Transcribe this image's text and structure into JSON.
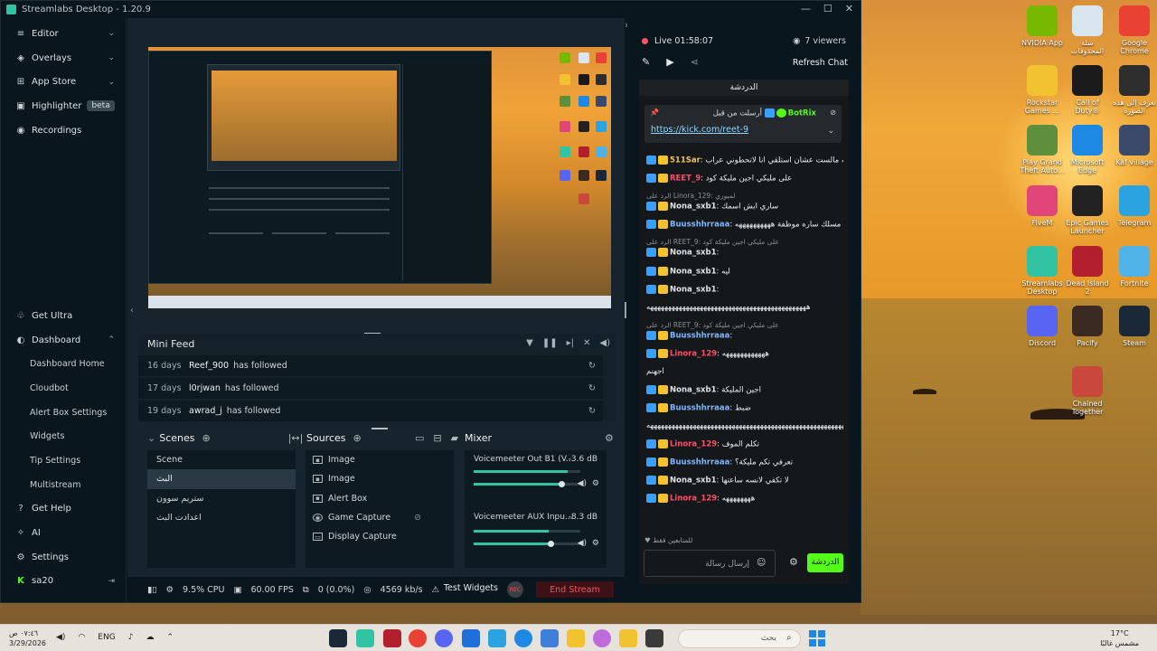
{
  "app": {
    "title": "Streamlabs Desktop - 1.20.9"
  },
  "sidebar": {
    "items": [
      {
        "label": "Editor"
      },
      {
        "label": "Overlays"
      },
      {
        "label": "App Store"
      },
      {
        "label": "Highlighter",
        "badge": "beta"
      },
      {
        "label": "Recordings"
      }
    ],
    "bottom": [
      {
        "label": "Get Ultra"
      },
      {
        "label": "Dashboard"
      }
    ],
    "dashboard_sub": [
      "Dashboard Home",
      "Cloudbot",
      "Alert Box Settings",
      "Widgets",
      "Tip Settings",
      "Multistream"
    ],
    "footer": [
      {
        "label": "Get Help"
      },
      {
        "label": "AI"
      },
      {
        "label": "Settings"
      }
    ],
    "user": "sa20"
  },
  "minifeed": {
    "title": "Mini Feed",
    "rows": [
      {
        "days": "16 days",
        "name": "Reef_900",
        "action": "has followed"
      },
      {
        "days": "17 days",
        "name": "l0rjwan",
        "action": "has followed"
      },
      {
        "days": "19 days",
        "name": "awrad_j",
        "action": "has followed"
      }
    ]
  },
  "scenes": {
    "title": "Scenes",
    "items": [
      "Scene",
      "البث",
      "ستريم سوون",
      "اعدادت البث"
    ]
  },
  "sources": {
    "title": "Sources",
    "items": [
      "Image",
      "Image",
      "Alert Box",
      "Game Capture",
      "Display Capture"
    ]
  },
  "mixer": {
    "title": "Mixer",
    "channels": [
      {
        "name": "Voicemeeter Out B1 (V...",
        "db": "-3.6 dB",
        "level": 0.88,
        "volume": 0.82
      },
      {
        "name": "Voicemeeter AUX Inpu...",
        "db": "-8.3 dB",
        "level": 0.7,
        "volume": 0.72
      }
    ]
  },
  "status": {
    "cpu": "9.5% CPU",
    "fps": "60.00 FPS",
    "dropped": "0 (0.0%)",
    "bitrate": "4569 kb/s",
    "test_widgets": "Test Widgets",
    "end_stream": "End Stream"
  },
  "stream": {
    "live": "Live 01:58:07",
    "viewers": "7 viewers",
    "refresh": "Refresh Chat"
  },
  "chat": {
    "tab": "الدردشة",
    "pinned_by": "أرسلت من قبل",
    "pinned_user": "BotRix",
    "pinned_link": "https://kick.com/reet-9",
    "messages": [
      {
        "user": "511Sar",
        "text": "بداوم والله مالست عشان استلقي انا لاتحطوني عراب",
        "color": "#f0c35b"
      },
      {
        "user": "REET_9",
        "text": "على مليكي اجين مليكة كود",
        "color": "#ff4e6a"
      },
      {
        "reply": "الرد على Linora_129: لمبوري"
      },
      {
        "user": "Nona_sxb1",
        "text": "ساري ابش اسمك",
        "color": "#dfe3e6"
      },
      {
        "user": "Buusshhrraaa",
        "text": "لالا مسلك ساره موظفة ههههههههههه",
        "color": "#7fb7ff"
      },
      {
        "reply": "الرد على REET_9: على مليكي اجين مليكة كود"
      },
      {
        "user": "Nona_sxb1",
        "text": "",
        "color": "#dfe3e6"
      },
      {
        "user": "Nona_sxb1",
        "text": "ليه",
        "color": "#dfe3e6"
      },
      {
        "user": "Nona_sxb1",
        "text": "",
        "color": "#dfe3e6"
      },
      {
        "text": "هههههههههههههههههههههههههههههههههههههههههههههه"
      },
      {
        "reply": "الرد على REET_9: على مليكي اجين مليكة كود"
      },
      {
        "user": "Buusshhrraaa",
        "text": "",
        "color": "#7fb7ff"
      },
      {
        "user": "Linora_129",
        "text": "ههههههههههههه",
        "color": "#ff4e6a"
      },
      {
        "text": "اجهنم"
      },
      {
        "user": "Nona_sxb1",
        "text": "اجين المليكة",
        "color": "#dfe3e6"
      },
      {
        "user": "Buusshhrraaa",
        "text": "ضبط",
        "color": "#7fb7ff"
      },
      {
        "text": "هههههههههههههههههههههههههههههههههههههههههههههههههههههههههههههههههههه"
      },
      {
        "user": "Linora_129",
        "text": "تكلم الموف",
        "color": "#ff4e6a"
      },
      {
        "user": "Buusshhrraaa",
        "text": "تعرفي تكم مليكة؟",
        "color": "#7fb7ff"
      },
      {
        "user": "Nona_sxb1",
        "text": "لا تكفي لانسه ساعتها",
        "color": "#dfe3e6"
      },
      {
        "user": "Linora_129",
        "text": "ههههههههه",
        "color": "#ff4e6a"
      }
    ],
    "followers_only": "للمتابعين فقط",
    "input_placeholder": "إرسال رسالة",
    "send": "الدردشة"
  },
  "desktop": {
    "icons": [
      {
        "label": "NVIDIA App",
        "color": "#76b900"
      },
      {
        "label": "سلة المحذوفات",
        "color": "#d9e6ef"
      },
      {
        "label": "Google Chrome",
        "color": "#e94235"
      },
      {
        "label": "Rockstar Games ...",
        "color": "#f2c230"
      },
      {
        "label": "Call of Duty®",
        "color": "#1b1b1b"
      },
      {
        "label": "تعرف إلى هذه الصورة",
        "color": "#2d2d2d"
      },
      {
        "label": "Play Grand Theft Auto...",
        "color": "#5e8f3c"
      },
      {
        "label": "Microsoft Edge",
        "color": "#1e88e5"
      },
      {
        "label": "Kaf village",
        "color": "#3b4a6b"
      },
      {
        "label": "FiveM",
        "color": "#e2457a"
      },
      {
        "label": "Epic Games Launcher",
        "color": "#222222"
      },
      {
        "label": "Telegram",
        "color": "#2aa3e0"
      },
      {
        "label": "Streamlabs Desktop",
        "color": "#31c3a2"
      },
      {
        "label": "Dead Island 2",
        "color": "#b21f2d"
      },
      {
        "label": "Fortnite",
        "color": "#4fb3e8"
      },
      {
        "label": "Discord",
        "color": "#5865f2"
      },
      {
        "label": "Pacify",
        "color": "#3a2a22"
      },
      {
        "label": "Steam",
        "color": "#1b2838"
      },
      {
        "label": "Chained Together",
        "color": "#c9473b"
      }
    ]
  },
  "taskbar": {
    "time": "٠٧:٤٦ ص",
    "date": "3/29/2026",
    "lang": "ENG",
    "search": "بحث",
    "weather_temp": "17°C",
    "weather_desc": "مشمس غالبًا"
  }
}
